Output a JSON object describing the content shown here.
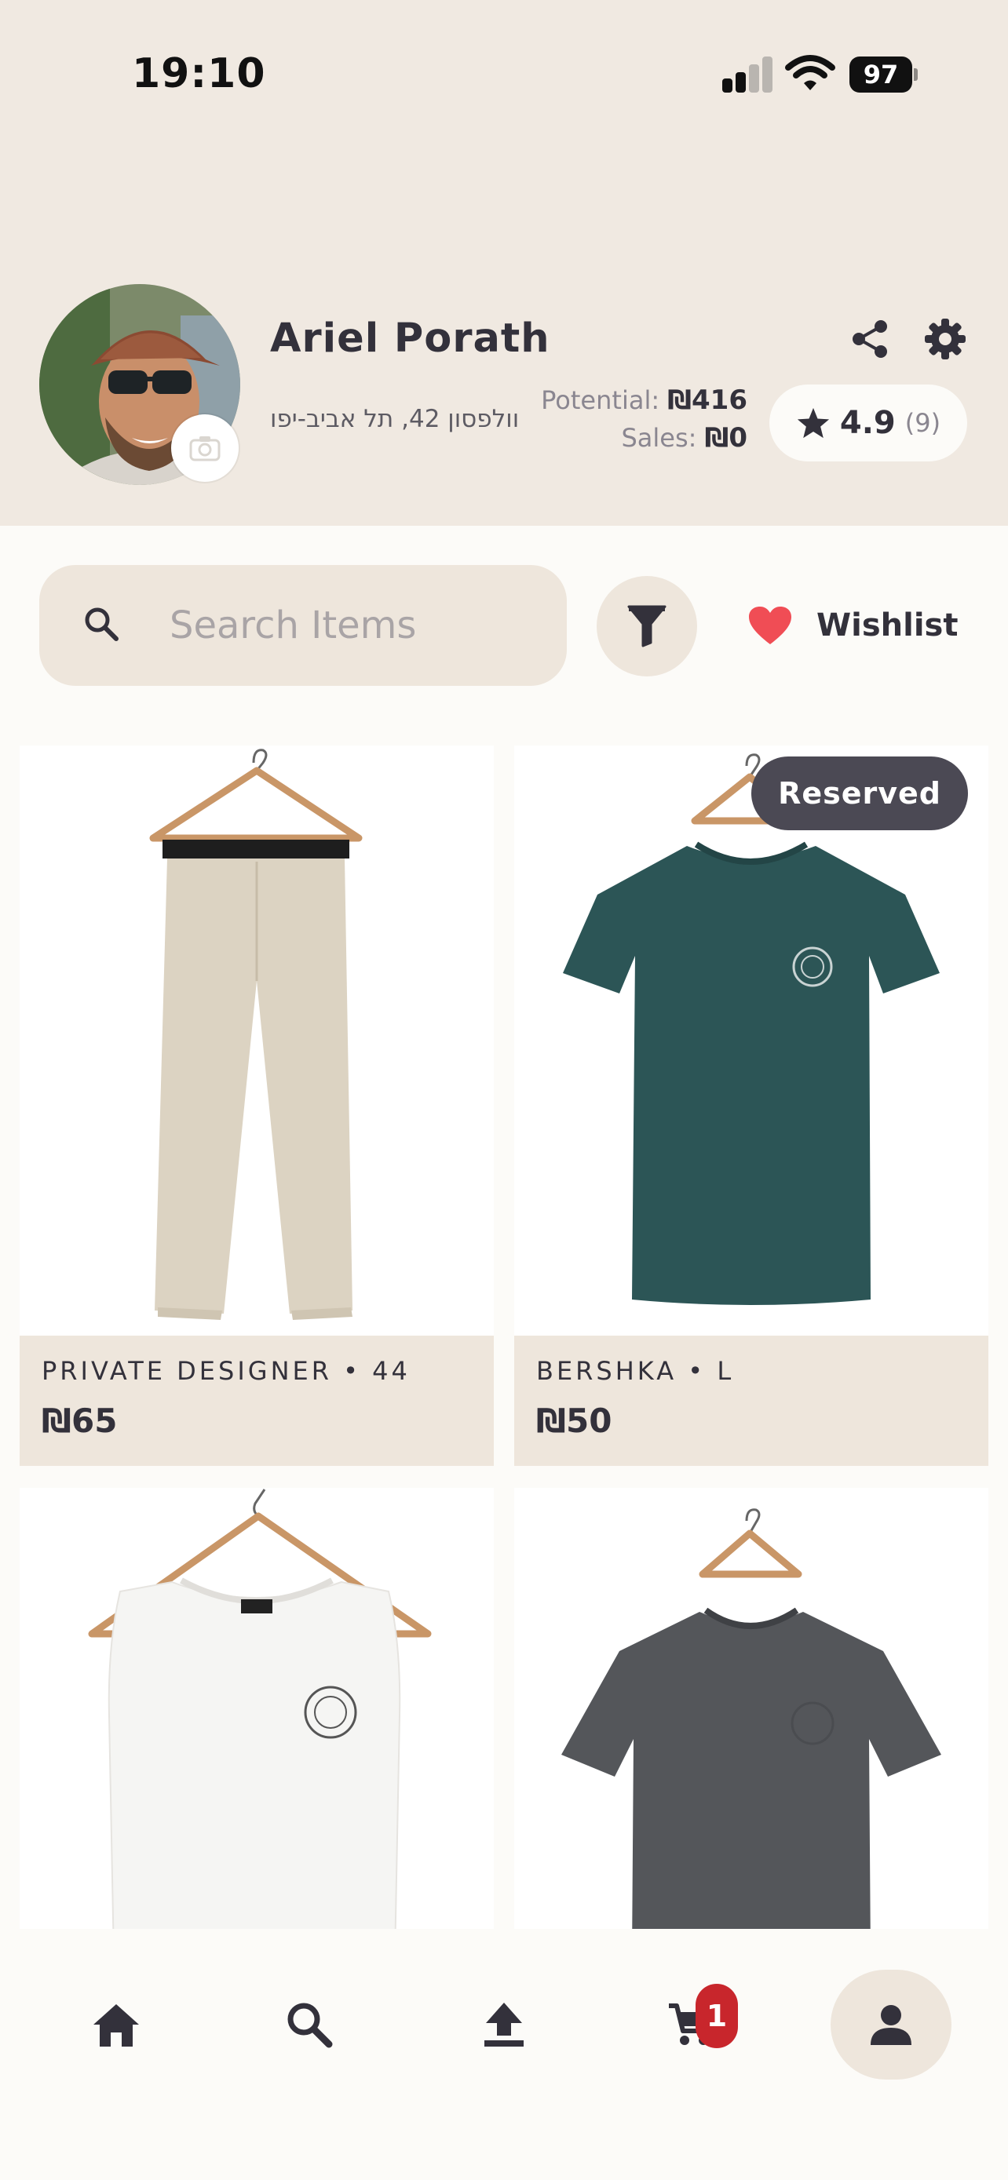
{
  "status_bar": {
    "time": "19:10",
    "battery": "97"
  },
  "profile": {
    "name": "Ariel Porath",
    "address": "וולפסון 42, תל אביב-יפו",
    "potential_label": "Potential:",
    "potential_value": "₪416",
    "sales_label": "Sales:",
    "sales_value": "₪0",
    "rating": "4.9",
    "rating_count": "(9)",
    "icons": [
      "camera-icon",
      "share-icon",
      "gear-icon",
      "star-icon"
    ]
  },
  "search": {
    "placeholder": "Search Items",
    "value": ""
  },
  "wishlist": {
    "label": "Wishlist"
  },
  "items": [
    {
      "meta": "PRIVATE DESIGNER • 44",
      "price": "₪65",
      "image": "beige trousers on hanger"
    },
    {
      "meta": "BERSHKA • L",
      "price": "₪50",
      "image": "teal t-shirt on hanger",
      "badge": "Reserved"
    },
    {
      "image": "white sleeveless top on hanger"
    },
    {
      "image": "dark grey t-shirt on hanger"
    }
  ],
  "tabbar": {
    "tabs": [
      "home",
      "search",
      "upload",
      "cart",
      "profile"
    ],
    "cart_count": "1",
    "active": "profile"
  },
  "colors": {
    "header_bg": "#F0E9E1",
    "page_bg": "#FCFBF8",
    "card_info_bg": "#EEE6DC",
    "text_dark": "#33313B",
    "heart": "#F04D55",
    "badge_red": "#C8262C",
    "teal_shirt": "#2C5556"
  }
}
